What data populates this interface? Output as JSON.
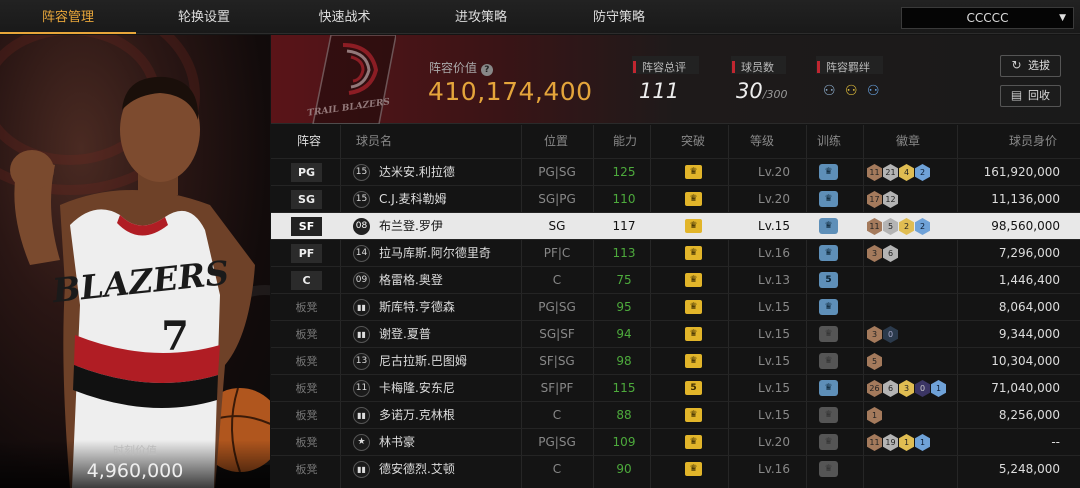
{
  "nav": {
    "tabs": [
      "阵容管理",
      "轮换设置",
      "快速战术",
      "进攻策略",
      "防守策略"
    ],
    "active_tab": "阵容管理",
    "team_select": "CCCCC"
  },
  "player_card": {
    "team_wordmark": "BLAZERS",
    "jersey_number": "7",
    "value_label": "时刻价值",
    "value": "4,960,000"
  },
  "header": {
    "team_logo_text": "TRAIL BLAZERS",
    "lineup_value_label": "阵容价值",
    "lineup_value": "410,174,400",
    "overall_label": "阵容总评",
    "overall": "111",
    "players_label": "球员数",
    "players_count": "30",
    "players_max": "/300",
    "bonds_label": "阵容羁绊",
    "select_button": "选拔",
    "recycle_button": "回收"
  },
  "table": {
    "columns": [
      "阵容",
      "球员名",
      "位置",
      "能力",
      "突破",
      "等级",
      "训练",
      "徽章",
      "球员身价"
    ],
    "rows": [
      {
        "slot": "PG",
        "starter": true,
        "jersey": "15",
        "name": "达米安.利拉德",
        "position": "PG|SG",
        "ability": "125",
        "break": "",
        "level": "Lv.20",
        "train": "",
        "badges": [
          [
            "11",
            "bronze"
          ],
          [
            "21",
            "silver"
          ],
          [
            "4",
            "gold"
          ],
          [
            "2",
            "blue"
          ]
        ],
        "value": "161,920,000"
      },
      {
        "slot": "SG",
        "starter": true,
        "jersey": "15",
        "name": "C.J.麦科勒姆",
        "position": "SG|PG",
        "ability": "110",
        "break": "",
        "level": "Lv.20",
        "train": "",
        "badges": [
          [
            "17",
            "bronze"
          ],
          [
            "12",
            "silver"
          ]
        ],
        "value": "11,136,000"
      },
      {
        "slot": "SF",
        "starter": true,
        "selected": true,
        "jersey": "08",
        "name": "布兰登.罗伊",
        "position": "SG",
        "ability": "117",
        "break": "",
        "level": "Lv.15",
        "train": "",
        "badges": [
          [
            "11",
            "bronze"
          ],
          [
            "5",
            "silver"
          ],
          [
            "2",
            "gold"
          ],
          [
            "2",
            "blue"
          ]
        ],
        "value": "98,560,000"
      },
      {
        "slot": "PF",
        "starter": true,
        "jersey": "14",
        "name": "拉马库斯.阿尔德里奇",
        "position": "PF|C",
        "ability": "113",
        "break": "",
        "level": "Lv.16",
        "train": "",
        "badges": [
          [
            "3",
            "bronze"
          ],
          [
            "6",
            "silver"
          ]
        ],
        "value": "7,296,000"
      },
      {
        "slot": "C",
        "starter": true,
        "jersey": "09",
        "name": "格雷格.奥登",
        "position": "C",
        "ability": "75",
        "break": "",
        "level": "Lv.13",
        "train": "5",
        "badges": [],
        "value": "1,446,400"
      },
      {
        "slot": "板凳",
        "starter": false,
        "jersey": "",
        "name": "斯库特.亨德森",
        "position": "PG|SG",
        "ability": "95",
        "break": "",
        "level": "Lv.15",
        "train": "",
        "badges": [],
        "value": "8,064,000"
      },
      {
        "slot": "板凳",
        "starter": false,
        "jersey": "",
        "name": "谢登.夏普",
        "position": "SG|SF",
        "ability": "94",
        "break": "",
        "level": "Lv.15",
        "train": "grey",
        "badges": [
          [
            "3",
            "bronze"
          ],
          [
            "0",
            "teal"
          ]
        ],
        "value": "9,344,000"
      },
      {
        "slot": "板凳",
        "starter": false,
        "jersey": "13",
        "name": "尼古拉斯.巴图姆",
        "position": "SF|SG",
        "ability": "98",
        "break": "",
        "level": "Lv.15",
        "train": "grey",
        "badges": [
          [
            "5",
            "bronze"
          ]
        ],
        "value": "10,304,000"
      },
      {
        "slot": "板凳",
        "starter": false,
        "jersey": "11",
        "name": "卡梅隆.安东尼",
        "position": "SF|PF",
        "ability": "115",
        "break": "5",
        "level": "Lv.15",
        "train": "",
        "badges": [
          [
            "26",
            "bronze"
          ],
          [
            "6",
            "silver"
          ],
          [
            "3",
            "gold"
          ],
          [
            "0",
            "purple"
          ],
          [
            "1",
            "blue"
          ]
        ],
        "value": "71,040,000"
      },
      {
        "slot": "板凳",
        "starter": false,
        "jersey": "",
        "name": "多诺万.克林根",
        "position": "C",
        "ability": "88",
        "break": "",
        "level": "Lv.15",
        "train": "grey",
        "badges": [
          [
            "1",
            "bronze"
          ]
        ],
        "value": "8,256,000"
      },
      {
        "slot": "板凳",
        "starter": false,
        "jersey": "★",
        "name": "林书豪",
        "position": "PG|SG",
        "ability": "109",
        "break": "",
        "level": "Lv.20",
        "train": "grey",
        "badges": [
          [
            "11",
            "bronze"
          ],
          [
            "19",
            "silver"
          ],
          [
            "1",
            "gold"
          ],
          [
            "1",
            "blue"
          ]
        ],
        "value": "--"
      },
      {
        "slot": "板凳",
        "starter": false,
        "jersey": "",
        "name": "德安德烈.艾顿",
        "position": "C",
        "ability": "90",
        "break": "",
        "level": "Lv.16",
        "train": "grey",
        "badges": [],
        "value": "5,248,000"
      }
    ]
  }
}
